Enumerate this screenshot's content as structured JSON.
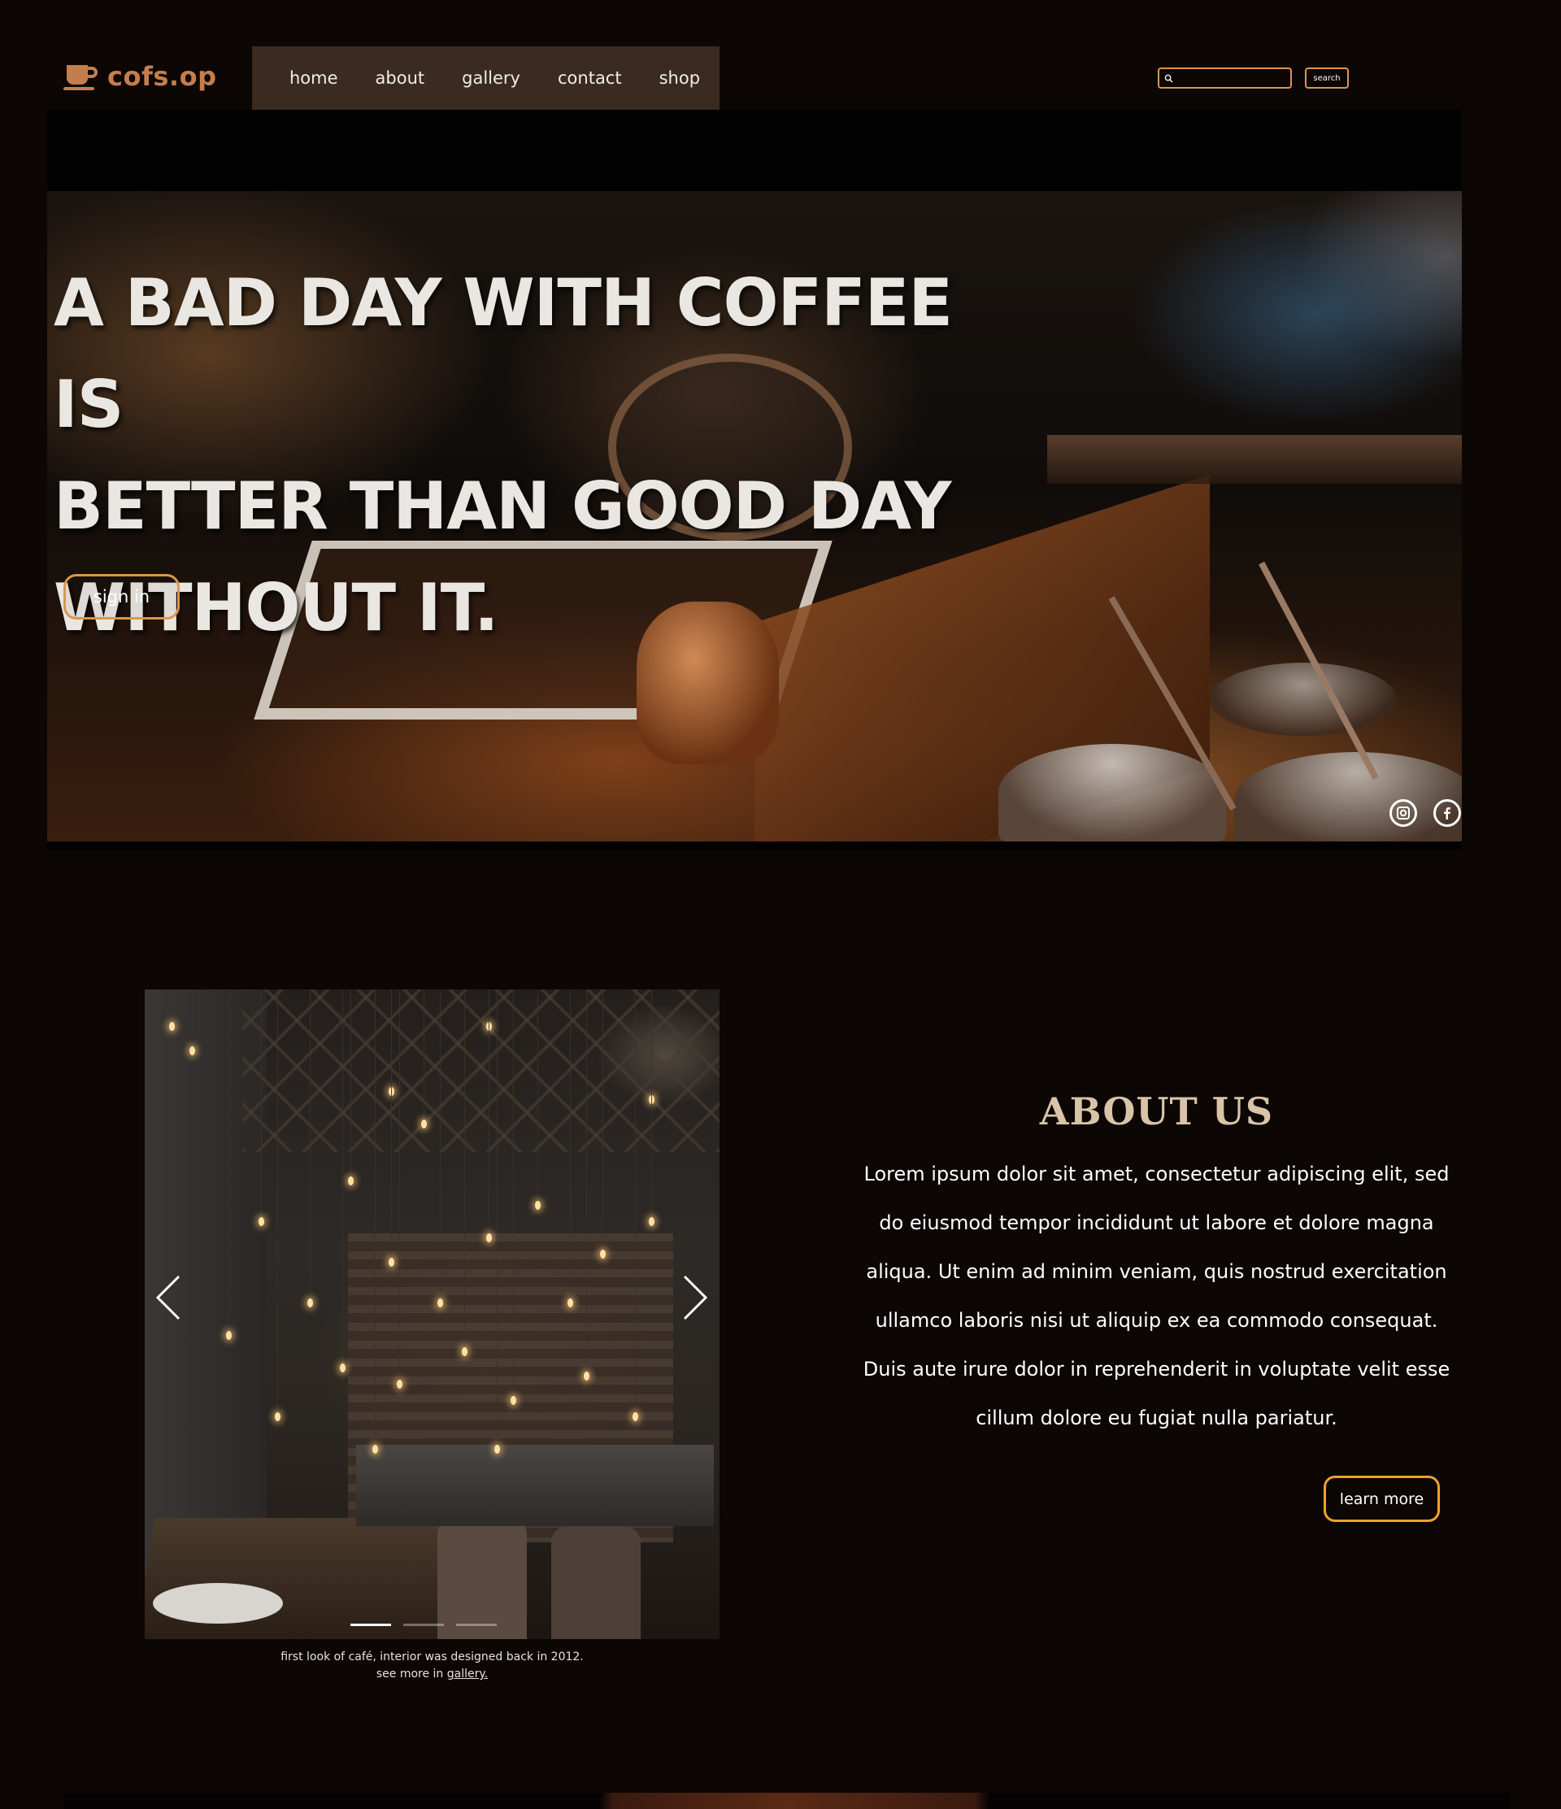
{
  "header": {
    "logo_text": "cofs.op",
    "nav": [
      "home",
      "about",
      "gallery",
      "contact",
      "shop"
    ],
    "search": {
      "placeholder": "",
      "button_label": "search"
    }
  },
  "hero": {
    "title_lines": [
      "A BAD DAY WITH COFFEE IS",
      "BETTER THAN GOOD DAY",
      "WITHOUT IT."
    ],
    "signin_label": "sign in",
    "social_icons": [
      "instagram-icon",
      "facebook-icon"
    ]
  },
  "about": {
    "title": "ABOUT US",
    "text": "Lorem ipsum dolor sit amet, consectetur adipiscing elit, sed do eiusmod tempor incididunt ut labore et dolore magna aliqua. Ut enim ad minim veniam, quis nostrud exercitation ullamco laboris nisi ut aliquip ex ea commodo consequat. Duis aute irure dolor in reprehenderit in voluptate velit esse cillum dolore eu fugiat nulla pariatur.",
    "learn_more_label": "learn more",
    "carousel": {
      "caption_line1": "first look of café, interior was designed back in 2012.",
      "caption_line2_prefix": "see more in ",
      "caption_link": "gallery.",
      "slides": 3,
      "active_slide": 1
    }
  },
  "colors": {
    "background": "#0c0605",
    "nav_background": "#3a2a20",
    "accent": "#d9964f",
    "logo": "#c47e4d",
    "button_border_learn": "#f0a22b",
    "about_title": "#d9c4a8"
  }
}
